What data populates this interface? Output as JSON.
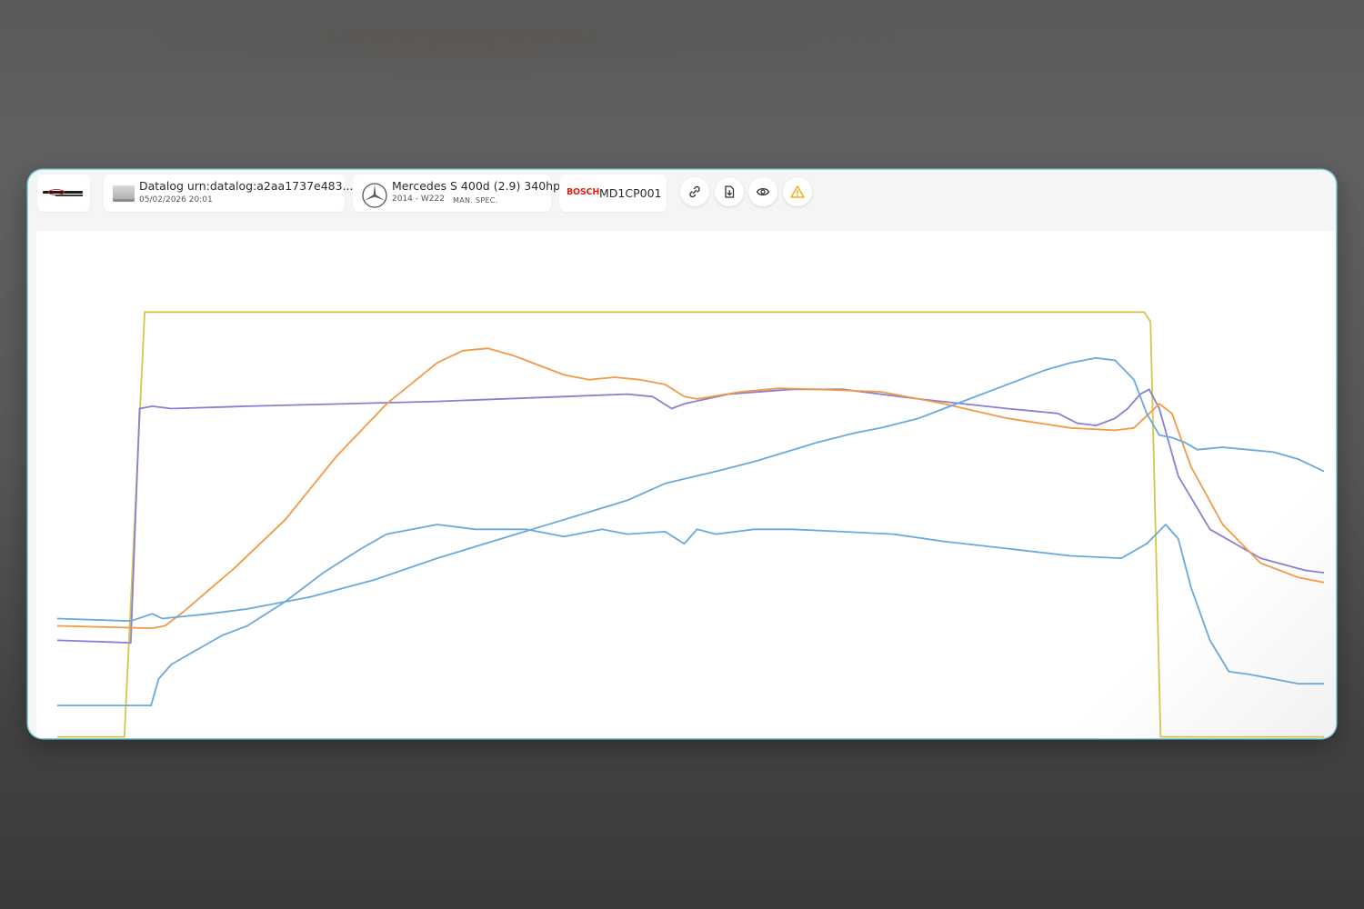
{
  "window": {
    "datalog": {
      "title": "Datalog urn:datalog:a2aa1737e483...",
      "timestamp": "05/02/2026 20:01",
      "icon": "ecu-device-icon"
    },
    "vehicle": {
      "title": "Mercedes S 400d (2.9) 340hp",
      "subtitle": "2014 - W222",
      "spec": "MAN. SPEC.",
      "icon": "mercedes-logo-icon"
    },
    "ecu": {
      "brand": "BOSCH",
      "model": "MD1CP001"
    },
    "actions": [
      {
        "name": "link-icon"
      },
      {
        "name": "download-icon"
      },
      {
        "name": "eye-icon"
      },
      {
        "name": "warning-icon"
      }
    ],
    "colors": {
      "accent_border": "#7fd6de",
      "warning": "#f2b01e",
      "brand_red": "#e2231a"
    }
  },
  "chart_data": {
    "type": "line",
    "title": "",
    "xlabel": "",
    "ylabel": "",
    "grid": false,
    "legend": "none",
    "x_range": [
      0,
      100
    ],
    "y_range": [
      0,
      100
    ],
    "series": [
      {
        "color": "#d4c64a",
        "points": [
          [
            0,
            -2
          ],
          [
            5.3,
            -2
          ],
          [
            6.9,
            86
          ],
          [
            85.8,
            86
          ],
          [
            86.3,
            84
          ],
          [
            87.1,
            -2
          ],
          [
            100,
            -2
          ]
        ]
      },
      {
        "color": "#8a7fd0",
        "points": [
          [
            0,
            18
          ],
          [
            5.8,
            17.5
          ],
          [
            6.5,
            66
          ],
          [
            7.5,
            66.5
          ],
          [
            9,
            66
          ],
          [
            15,
            66.5
          ],
          [
            30,
            67.5
          ],
          [
            45,
            69
          ],
          [
            47,
            68.5
          ],
          [
            48.5,
            66
          ],
          [
            49.5,
            67
          ],
          [
            53,
            69
          ],
          [
            58,
            70
          ],
          [
            62,
            70
          ],
          [
            68,
            68
          ],
          [
            75,
            66
          ],
          [
            79,
            65
          ],
          [
            80.5,
            63
          ],
          [
            82,
            62.5
          ],
          [
            83.5,
            64
          ],
          [
            84.5,
            66
          ],
          [
            85.5,
            69
          ],
          [
            86.2,
            70
          ],
          [
            87,
            66
          ],
          [
            88.5,
            52
          ],
          [
            91,
            41
          ],
          [
            95,
            35
          ],
          [
            98.5,
            32.5
          ],
          [
            100,
            32
          ]
        ]
      },
      {
        "color": "#f29a45",
        "points": [
          [
            0,
            21
          ],
          [
            7.5,
            20.5
          ],
          [
            8.5,
            21
          ],
          [
            10,
            24
          ],
          [
            14,
            33
          ],
          [
            18,
            43
          ],
          [
            22,
            56
          ],
          [
            26,
            67
          ],
          [
            30,
            75.5
          ],
          [
            32,
            78
          ],
          [
            34,
            78.5
          ],
          [
            36,
            77
          ],
          [
            40,
            73
          ],
          [
            42,
            72
          ],
          [
            44,
            72.5
          ],
          [
            46,
            72
          ],
          [
            48,
            71
          ],
          [
            49.5,
            68.5
          ],
          [
            50.5,
            68
          ],
          [
            54,
            69.5
          ],
          [
            57,
            70.2
          ],
          [
            60,
            70
          ],
          [
            65,
            69.5
          ],
          [
            70,
            67
          ],
          [
            75,
            64
          ],
          [
            80,
            62
          ],
          [
            83.5,
            61.5
          ],
          [
            85,
            62
          ],
          [
            86.2,
            65
          ],
          [
            87,
            67
          ],
          [
            88,
            65
          ],
          [
            89.5,
            54
          ],
          [
            92,
            42
          ],
          [
            95,
            34
          ],
          [
            98,
            31
          ],
          [
            100,
            30
          ]
        ]
      },
      {
        "color": "#6aa9dc",
        "points": [
          [
            0,
            22.5
          ],
          [
            5.8,
            22
          ],
          [
            7.5,
            23.5
          ],
          [
            8.3,
            22.5
          ],
          [
            12,
            23.5
          ],
          [
            15,
            24.5
          ],
          [
            20,
            27
          ],
          [
            25,
            30.5
          ],
          [
            30,
            35
          ],
          [
            35,
            39
          ],
          [
            40,
            43
          ],
          [
            45,
            47
          ],
          [
            48,
            50.5
          ],
          [
            52,
            53
          ],
          [
            55,
            55
          ],
          [
            60,
            59
          ],
          [
            63,
            61
          ],
          [
            65,
            62
          ],
          [
            68,
            64
          ],
          [
            70,
            66
          ],
          [
            72,
            68
          ],
          [
            74,
            70
          ],
          [
            76,
            72
          ],
          [
            78,
            74
          ],
          [
            80,
            75.5
          ],
          [
            82,
            76.5
          ],
          [
            83.5,
            76
          ],
          [
            85,
            72
          ],
          [
            86,
            65
          ],
          [
            87,
            60.5
          ],
          [
            88,
            60
          ],
          [
            89,
            59
          ],
          [
            90,
            57.5
          ],
          [
            92,
            58
          ],
          [
            94,
            57.5
          ],
          [
            96,
            57
          ],
          [
            98,
            55.5
          ],
          [
            100,
            53
          ]
        ]
      },
      {
        "color": "#6aa9dc",
        "points": [
          [
            0,
            4.5
          ],
          [
            6.5,
            4.5
          ],
          [
            7.4,
            4.5
          ],
          [
            8,
            10
          ],
          [
            9,
            13
          ],
          [
            11,
            16
          ],
          [
            13,
            19
          ],
          [
            15,
            21
          ],
          [
            18,
            26
          ],
          [
            21,
            32
          ],
          [
            24,
            37
          ],
          [
            26,
            40
          ],
          [
            30,
            42
          ],
          [
            33,
            41
          ],
          [
            37,
            41
          ],
          [
            40,
            39.5
          ],
          [
            43,
            41
          ],
          [
            45,
            40
          ],
          [
            48,
            40.5
          ],
          [
            49.5,
            38
          ],
          [
            50.5,
            41
          ],
          [
            52,
            40
          ],
          [
            55,
            41
          ],
          [
            58,
            41
          ],
          [
            62,
            40.5
          ],
          [
            66,
            40
          ],
          [
            70,
            38.5
          ],
          [
            75,
            37
          ],
          [
            80,
            35.5
          ],
          [
            84,
            35
          ],
          [
            86,
            38
          ],
          [
            87.5,
            42
          ],
          [
            88.5,
            39
          ],
          [
            89.5,
            29
          ],
          [
            91,
            18
          ],
          [
            92.5,
            11.5
          ],
          [
            94,
            11
          ],
          [
            96,
            10
          ],
          [
            98,
            9
          ],
          [
            100,
            9
          ]
        ]
      }
    ]
  }
}
